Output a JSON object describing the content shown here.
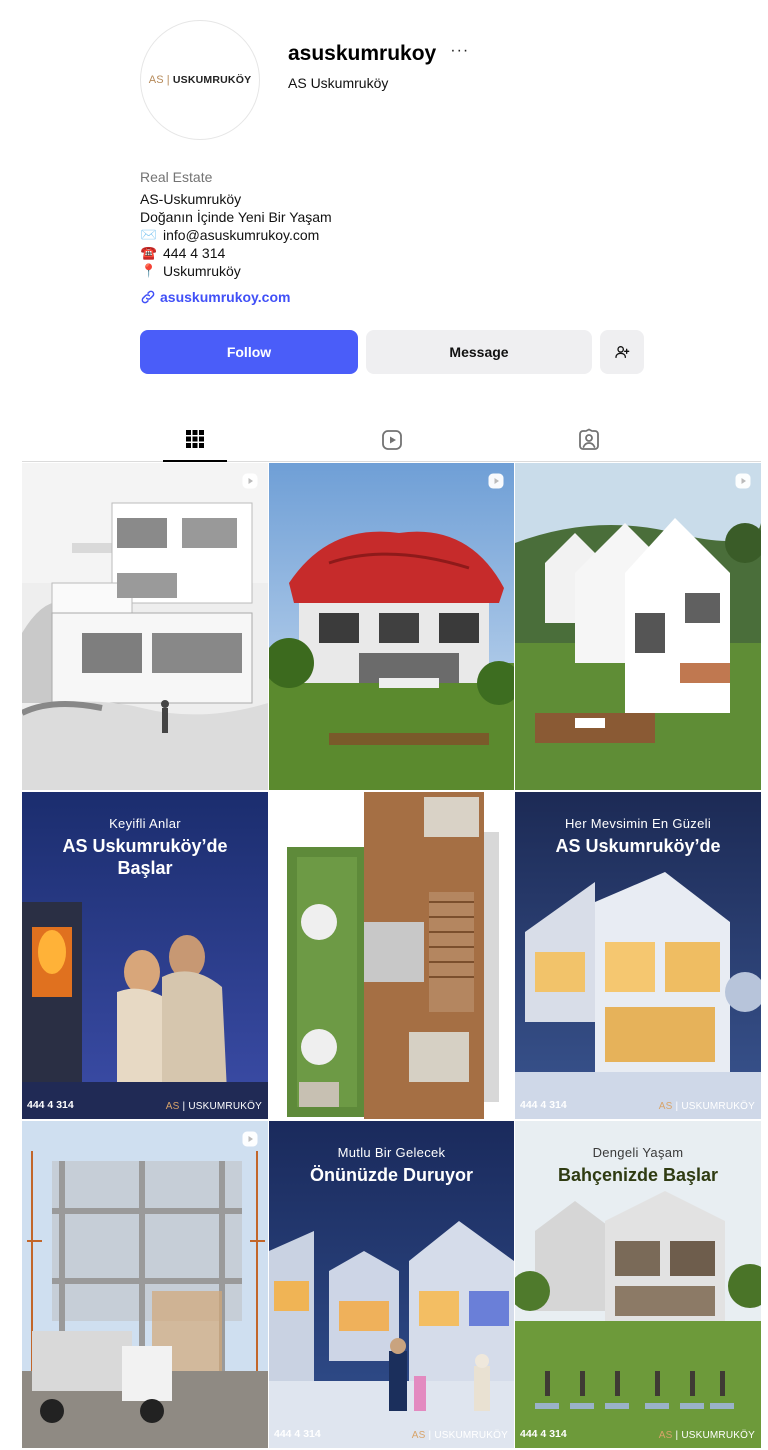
{
  "profile": {
    "avatar_logo_as": "AS",
    "avatar_logo_name": "USKUMRUKÖY",
    "username": "asuskumrukoy",
    "more_label": "···",
    "full_name": "AS Uskumruköy"
  },
  "bio": {
    "category": "Real Estate",
    "lines": [
      {
        "emoji": "",
        "text": "AS-Uskumruköy"
      },
      {
        "emoji": "",
        "text": "Doğanın İçinde Yeni Bir Yaşam"
      },
      {
        "emoji": "✉️",
        "text": "info@asuskumrukoy.com"
      },
      {
        "emoji": "☎️",
        "text": "444 4 314"
      },
      {
        "emoji": "📍",
        "text": "Uskumruköy"
      }
    ],
    "link": "asuskumrukoy.com"
  },
  "actions": {
    "follow_label": "Follow",
    "message_label": "Message",
    "add_icon": "add-person-icon"
  },
  "tabs": [
    {
      "name": "posts",
      "icon": "grid-icon",
      "active": true
    },
    {
      "name": "reels",
      "icon": "reels-icon",
      "active": false
    },
    {
      "name": "tagged",
      "icon": "tagged-icon",
      "active": false
    }
  ],
  "posts": [
    {
      "id": 1,
      "reel": true
    },
    {
      "id": 2,
      "reel": true
    },
    {
      "id": 3,
      "reel": true
    },
    {
      "id": 4,
      "reel": false,
      "small": "Keyifli Anlar",
      "big1": "AS Uskumruköy’de",
      "big2": "Başlar",
      "phone": "444 4 314",
      "brand_as": "AS",
      "brand_name": "USKUMRUKÖY"
    },
    {
      "id": 5,
      "reel": false
    },
    {
      "id": 6,
      "reel": false,
      "small": "Her Mevsimin En Güzeli",
      "big1": "AS Uskumruköy’de",
      "phone": "444 4 314",
      "brand_as": "AS",
      "brand_name": "USKUMRUKÖY"
    },
    {
      "id": 7,
      "reel": true
    },
    {
      "id": 8,
      "reel": false,
      "small": "Mutlu Bir Gelecek",
      "big1": "Önünüzde Duruyor",
      "phone": "444 4 314",
      "brand_as": "AS",
      "brand_name": "USKUMRUKÖY"
    },
    {
      "id": 9,
      "reel": false,
      "small": "Dengeli Yaşam",
      "big1": "Bahçenizde Başlar",
      "phone": "444 4 314",
      "brand_as": "AS",
      "brand_name": "USKUMRUKÖY"
    }
  ],
  "colors": {
    "follow_bg": "#4a5df9",
    "link": "#4150f7",
    "secondary_bg": "#efeff1",
    "brand_gold": "#d8a46a"
  }
}
